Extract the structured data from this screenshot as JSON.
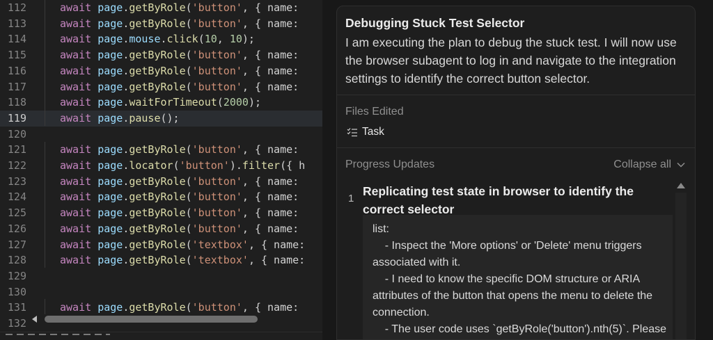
{
  "editor": {
    "lines": [
      {
        "num": "112",
        "tokens": [
          [
            "kw",
            "await "
          ],
          [
            "vr",
            "page"
          ],
          [
            "pn",
            "."
          ],
          [
            "fn",
            "getByRole"
          ],
          [
            "pn",
            "("
          ],
          [
            "st",
            "'button'"
          ],
          [
            "pn",
            ", { name:"
          ]
        ]
      },
      {
        "num": "113",
        "tokens": [
          [
            "kw",
            "await "
          ],
          [
            "vr",
            "page"
          ],
          [
            "pn",
            "."
          ],
          [
            "fn",
            "getByRole"
          ],
          [
            "pn",
            "("
          ],
          [
            "st",
            "'button'"
          ],
          [
            "pn",
            ", { name:"
          ]
        ]
      },
      {
        "num": "114",
        "tokens": [
          [
            "kw",
            "await "
          ],
          [
            "vr",
            "page"
          ],
          [
            "pn",
            "."
          ],
          [
            "vr",
            "mouse"
          ],
          [
            "pn",
            "."
          ],
          [
            "fn",
            "click"
          ],
          [
            "pn",
            "("
          ],
          [
            "nm",
            "10"
          ],
          [
            "pn",
            ", "
          ],
          [
            "nm",
            "10"
          ],
          [
            "pn",
            ");"
          ]
        ]
      },
      {
        "num": "115",
        "tokens": [
          [
            "kw",
            "await "
          ],
          [
            "vr",
            "page"
          ],
          [
            "pn",
            "."
          ],
          [
            "fn",
            "getByRole"
          ],
          [
            "pn",
            "("
          ],
          [
            "st",
            "'button'"
          ],
          [
            "pn",
            ", { name:"
          ]
        ]
      },
      {
        "num": "116",
        "tokens": [
          [
            "kw",
            "await "
          ],
          [
            "vr",
            "page"
          ],
          [
            "pn",
            "."
          ],
          [
            "fn",
            "getByRole"
          ],
          [
            "pn",
            "("
          ],
          [
            "st",
            "'button'"
          ],
          [
            "pn",
            ", { name:"
          ]
        ]
      },
      {
        "num": "117",
        "tokens": [
          [
            "kw",
            "await "
          ],
          [
            "vr",
            "page"
          ],
          [
            "pn",
            "."
          ],
          [
            "fn",
            "getByRole"
          ],
          [
            "pn",
            "("
          ],
          [
            "st",
            "'button'"
          ],
          [
            "pn",
            ", { name:"
          ]
        ]
      },
      {
        "num": "118",
        "tokens": [
          [
            "kw",
            "await "
          ],
          [
            "vr",
            "page"
          ],
          [
            "pn",
            "."
          ],
          [
            "fn",
            "waitForTimeout"
          ],
          [
            "pn",
            "("
          ],
          [
            "nm",
            "2000"
          ],
          [
            "pn",
            ");"
          ]
        ]
      },
      {
        "num": "119",
        "current": true,
        "tokens": [
          [
            "kw",
            "await "
          ],
          [
            "vr",
            "page"
          ],
          [
            "pn",
            "."
          ],
          [
            "fn",
            "pause"
          ],
          [
            "pn",
            "();"
          ]
        ]
      },
      {
        "num": "120",
        "tokens": []
      },
      {
        "num": "121",
        "tokens": [
          [
            "kw",
            "await "
          ],
          [
            "vr",
            "page"
          ],
          [
            "pn",
            "."
          ],
          [
            "fn",
            "getByRole"
          ],
          [
            "pn",
            "("
          ],
          [
            "st",
            "'button'"
          ],
          [
            "pn",
            ", { name:"
          ]
        ]
      },
      {
        "num": "122",
        "tokens": [
          [
            "kw",
            "await "
          ],
          [
            "vr",
            "page"
          ],
          [
            "pn",
            "."
          ],
          [
            "fn",
            "locator"
          ],
          [
            "pn",
            "("
          ],
          [
            "st",
            "'button'"
          ],
          [
            "pn",
            ")."
          ],
          [
            "fn",
            "filter"
          ],
          [
            "pn",
            "({ h"
          ]
        ]
      },
      {
        "num": "123",
        "tokens": [
          [
            "kw",
            "await "
          ],
          [
            "vr",
            "page"
          ],
          [
            "pn",
            "."
          ],
          [
            "fn",
            "getByRole"
          ],
          [
            "pn",
            "("
          ],
          [
            "st",
            "'button'"
          ],
          [
            "pn",
            ", { name:"
          ]
        ]
      },
      {
        "num": "124",
        "tokens": [
          [
            "kw",
            "await "
          ],
          [
            "vr",
            "page"
          ],
          [
            "pn",
            "."
          ],
          [
            "fn",
            "getByRole"
          ],
          [
            "pn",
            "("
          ],
          [
            "st",
            "'button'"
          ],
          [
            "pn",
            ", { name:"
          ]
        ]
      },
      {
        "num": "125",
        "tokens": [
          [
            "kw",
            "await "
          ],
          [
            "vr",
            "page"
          ],
          [
            "pn",
            "."
          ],
          [
            "fn",
            "getByRole"
          ],
          [
            "pn",
            "("
          ],
          [
            "st",
            "'button'"
          ],
          [
            "pn",
            ", { name:"
          ]
        ]
      },
      {
        "num": "126",
        "tokens": [
          [
            "kw",
            "await "
          ],
          [
            "vr",
            "page"
          ],
          [
            "pn",
            "."
          ],
          [
            "fn",
            "getByRole"
          ],
          [
            "pn",
            "("
          ],
          [
            "st",
            "'button'"
          ],
          [
            "pn",
            ", { name:"
          ]
        ]
      },
      {
        "num": "127",
        "tokens": [
          [
            "kw",
            "await "
          ],
          [
            "vr",
            "page"
          ],
          [
            "pn",
            "."
          ],
          [
            "fn",
            "getByRole"
          ],
          [
            "pn",
            "("
          ],
          [
            "st",
            "'textbox'"
          ],
          [
            "pn",
            ", { name:"
          ]
        ]
      },
      {
        "num": "128",
        "tokens": [
          [
            "kw",
            "await "
          ],
          [
            "vr",
            "page"
          ],
          [
            "pn",
            "."
          ],
          [
            "fn",
            "getByRole"
          ],
          [
            "pn",
            "("
          ],
          [
            "st",
            "'textbox'"
          ],
          [
            "pn",
            ", { name:"
          ]
        ]
      },
      {
        "num": "129",
        "tokens": []
      },
      {
        "num": "130",
        "tokens": []
      },
      {
        "num": "131",
        "tokens": [
          [
            "kw",
            "await "
          ],
          [
            "vr",
            "page"
          ],
          [
            "pn",
            "."
          ],
          [
            "fn",
            "getByRole"
          ],
          [
            "pn",
            "("
          ],
          [
            "st",
            "'button'"
          ],
          [
            "pn",
            ", { name:"
          ]
        ]
      },
      {
        "num": "132",
        "tokens": []
      }
    ]
  },
  "panel": {
    "task_title": "Debugging Stuck Test Selector",
    "task_description": "I am executing the plan to debug the stuck test. I will now use the browser subagent to log in and navigate to the integration settings to identify the correct button selector.",
    "files_edited_label": "Files Edited",
    "files": [
      {
        "icon": "task-list-icon",
        "name": "Task"
      }
    ],
    "progress_label": "Progress Updates",
    "collapse_label": "Collapse all",
    "updates": [
      {
        "number": "1",
        "title": "Replicating test state in browser to identify the correct selector",
        "details": [
          "list:",
          "    - Inspect the 'More options' or 'Delete' menu triggers",
          "associated with it.",
          "    - I need to know the specific DOM structure or ARIA",
          "attributes of the button that opens the menu to delete the",
          "connection.",
          "    - The user code uses `getByRole('button').nth(5)`. Please"
        ]
      }
    ]
  },
  "colors": {
    "keyword": "#c586c0",
    "variable": "#9cdcfe",
    "function": "#dcdcaa",
    "string": "#ce9178",
    "number": "#b5cea8",
    "editor_bg": "#1f1f1f",
    "panel_bg": "#1e1e1e"
  }
}
